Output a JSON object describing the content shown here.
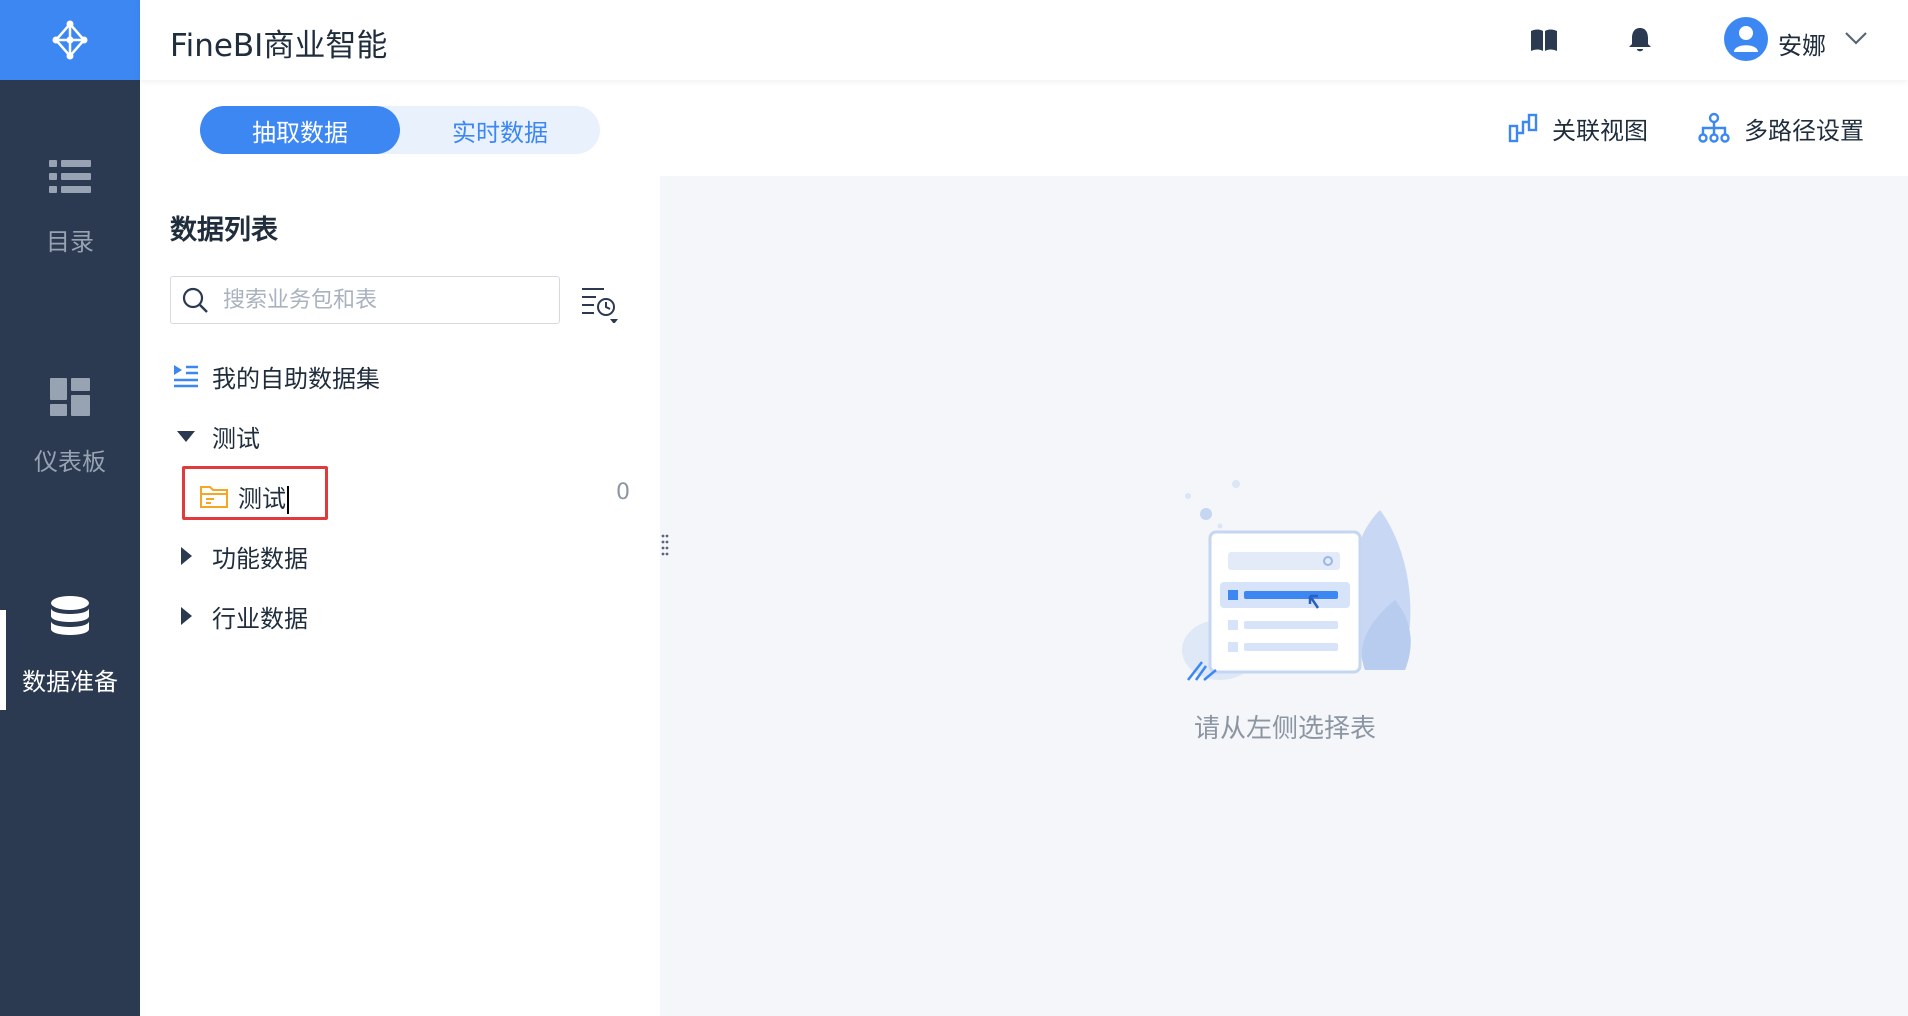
{
  "header": {
    "app_title": "FineBI商业智能",
    "user_name": "安娜",
    "icons": [
      "book-icon",
      "bell-icon",
      "user-avatar-icon",
      "chevron-down-icon"
    ]
  },
  "sidebar": {
    "items": [
      {
        "label": "目录",
        "icon": "list-icon",
        "active": false
      },
      {
        "label": "仪表板",
        "icon": "dashboard-icon",
        "active": false
      },
      {
        "label": "数据准备",
        "icon": "database-icon",
        "active": true
      }
    ]
  },
  "toolbar": {
    "tabs": [
      {
        "label": "抽取数据",
        "active": true
      },
      {
        "label": "实时数据",
        "active": false
      }
    ],
    "relation_view": "关联视图",
    "multipath": "多路径设置"
  },
  "data_list": {
    "title": "数据列表",
    "search_placeholder": "搜索业务包和表",
    "tree": [
      {
        "label": "我的自助数据集",
        "icon": "self-dataset-icon",
        "level": 0
      },
      {
        "label": "测试",
        "expanded": true,
        "level": 0
      },
      {
        "label": "测试",
        "icon": "folder-icon",
        "level": 1,
        "count": "0",
        "editing": true,
        "selected_outline": true
      },
      {
        "label": "功能数据",
        "expanded": false,
        "level": 0
      },
      {
        "label": "行业数据",
        "expanded": false,
        "level": 0
      }
    ]
  },
  "empty_state": {
    "text": "请从左侧选择表"
  },
  "colors": {
    "brand": "#3d87f3",
    "sidebar_bg": "#2b3a50",
    "highlight": "#e0393e",
    "folder": "#f5a623"
  }
}
